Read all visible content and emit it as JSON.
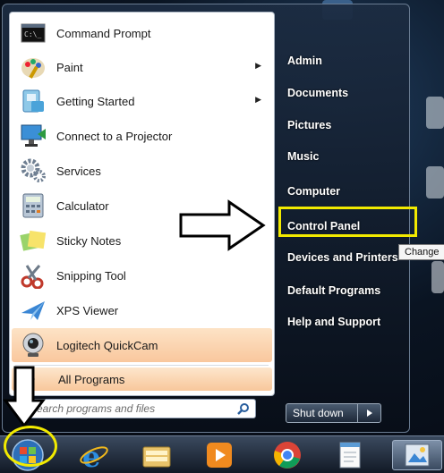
{
  "programs": [
    {
      "label": "Command Prompt",
      "icon": "command-prompt-icon",
      "has_submenu": false
    },
    {
      "label": "Paint",
      "icon": "paint-icon",
      "has_submenu": true
    },
    {
      "label": "Getting Started",
      "icon": "getting-started-icon",
      "has_submenu": true
    },
    {
      "label": "Connect to a Projector",
      "icon": "projector-icon",
      "has_submenu": false
    },
    {
      "label": "Services",
      "icon": "services-icon",
      "has_submenu": false
    },
    {
      "label": "Calculator",
      "icon": "calculator-icon",
      "has_submenu": false
    },
    {
      "label": "Sticky Notes",
      "icon": "sticky-notes-icon",
      "has_submenu": false
    },
    {
      "label": "Snipping Tool",
      "icon": "snipping-tool-icon",
      "has_submenu": false
    },
    {
      "label": "XPS Viewer",
      "icon": "xps-viewer-icon",
      "has_submenu": false
    },
    {
      "label": "Logitech QuickCam",
      "icon": "webcam-icon",
      "has_submenu": false
    }
  ],
  "all_programs": {
    "label": "All Programs"
  },
  "search": {
    "placeholder": "Search programs and files"
  },
  "right_items": [
    {
      "label": "Admin"
    },
    {
      "label": "Documents"
    },
    {
      "label": "Pictures"
    },
    {
      "label": "Music"
    },
    {
      "label": "Computer"
    },
    {
      "label": "Control Panel"
    },
    {
      "label": "Devices and Printers"
    },
    {
      "label": "Default Programs"
    },
    {
      "label": "Help and Support"
    }
  ],
  "tooltip": {
    "text": "Change"
  },
  "shutdown": {
    "label": "Shut down"
  },
  "taskbar": {
    "items": [
      "start-orb-icon",
      "internet-explorer-icon",
      "file-explorer-icon",
      "media-player-icon",
      "chrome-icon",
      "notepad-icon",
      "image-viewer-icon"
    ]
  },
  "colors": {
    "highlight": "#f2ea00",
    "menu_hover": "#f9c79d"
  }
}
